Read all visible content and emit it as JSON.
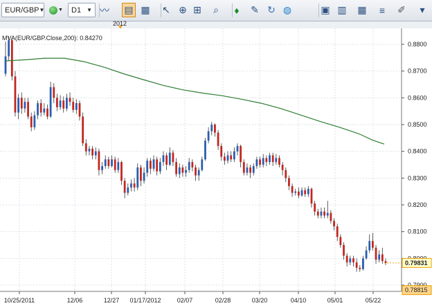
{
  "toolbar": {
    "symbol": "EUR/GBP",
    "timeframe": "D1",
    "tools": [
      {
        "name": "line-chart-icon",
        "x": 151
      },
      {
        "name": "chart-type-icon",
        "x": 186
      },
      {
        "name": "chart-window-icon",
        "x": 210
      },
      {
        "name": "cursor-icon",
        "x": 240
      },
      {
        "name": "crosshair-icon",
        "x": 264
      },
      {
        "name": "zoom-icon",
        "x": 285
      },
      {
        "name": "search-icon",
        "x": 312
      },
      {
        "name": "marker-icon",
        "x": 342
      },
      {
        "name": "note-icon",
        "x": 368
      },
      {
        "name": "refresh-icon",
        "x": 392
      },
      {
        "name": "globe-icon",
        "x": 415
      },
      {
        "name": "image-icon",
        "x": 470
      },
      {
        "name": "table-icon",
        "x": 494
      },
      {
        "name": "grid-icon",
        "x": 523
      },
      {
        "name": "lines-icon",
        "x": 552
      },
      {
        "name": "pen-icon",
        "x": 580
      },
      {
        "name": "options-icon",
        "x": 610
      }
    ]
  },
  "period_label": "2012",
  "indicator_label": "MVA(EUR/GBP.Close,200): 0.84270",
  "chart_data": {
    "type": "candlestick",
    "symbol": "EUR/GBP",
    "timeframe": "D1",
    "ylim": [
      0.787,
      0.88
    ],
    "yticks": [
      "0.8800",
      "0.8700",
      "0.8600",
      "0.8500",
      "0.8400",
      "0.8300",
      "0.8200",
      "0.8100",
      "0.8000",
      "0.7900"
    ],
    "xticks": [
      "10/25/2011",
      "12/06",
      "12/27",
      "01/17/2012",
      "02/07",
      "02/28",
      "03/20",
      "04/10",
      "05/01",
      "05/22"
    ],
    "last_price": "0.79831",
    "low_marker": "0.78815",
    "indicator": {
      "name": "MVA(EUR/GBP.Close,200)",
      "last_value": 0.8427
    },
    "candles": [
      [
        0.869,
        0.8755,
        0.881,
        0.868
      ],
      [
        0.8755,
        0.8815,
        0.883,
        0.874
      ],
      [
        0.8815,
        0.868,
        0.882,
        0.8665
      ],
      [
        0.868,
        0.8545,
        0.87,
        0.853
      ],
      [
        0.8545,
        0.86,
        0.8615,
        0.852
      ],
      [
        0.86,
        0.856,
        0.862,
        0.854
      ],
      [
        0.856,
        0.8585,
        0.86,
        0.8545
      ],
      [
        0.8585,
        0.853,
        0.86,
        0.852
      ],
      [
        0.853,
        0.849,
        0.8545,
        0.8475
      ],
      [
        0.849,
        0.8535,
        0.855,
        0.848
      ],
      [
        0.8535,
        0.858,
        0.859,
        0.852
      ],
      [
        0.858,
        0.8545,
        0.8595,
        0.853
      ],
      [
        0.8545,
        0.856,
        0.858,
        0.8535
      ],
      [
        0.856,
        0.853,
        0.8575,
        0.852
      ],
      [
        0.853,
        0.864,
        0.866,
        0.8525
      ],
      [
        0.864,
        0.86,
        0.8655,
        0.858
      ],
      [
        0.86,
        0.8565,
        0.8615,
        0.855
      ],
      [
        0.8565,
        0.859,
        0.861,
        0.8555
      ],
      [
        0.859,
        0.856,
        0.8605,
        0.8545
      ],
      [
        0.856,
        0.86,
        0.8615,
        0.855
      ],
      [
        0.86,
        0.8585,
        0.862,
        0.857
      ],
      [
        0.8585,
        0.8555,
        0.86,
        0.8545
      ],
      [
        0.8555,
        0.858,
        0.8595,
        0.854
      ],
      [
        0.858,
        0.853,
        0.859,
        0.8515
      ],
      [
        0.853,
        0.843,
        0.8545,
        0.842
      ],
      [
        0.843,
        0.84,
        0.8445,
        0.8385
      ],
      [
        0.84,
        0.841,
        0.842,
        0.8385
      ],
      [
        0.841,
        0.8385,
        0.842,
        0.837
      ],
      [
        0.8385,
        0.84,
        0.8415,
        0.837
      ],
      [
        0.84,
        0.833,
        0.841,
        0.831
      ],
      [
        0.833,
        0.8345,
        0.836,
        0.8315
      ],
      [
        0.8345,
        0.837,
        0.8385,
        0.8335
      ],
      [
        0.837,
        0.8345,
        0.838,
        0.8335
      ],
      [
        0.8345,
        0.837,
        0.8385,
        0.834
      ],
      [
        0.837,
        0.833,
        0.838,
        0.832
      ],
      [
        0.833,
        0.836,
        0.8375,
        0.832
      ],
      [
        0.836,
        0.829,
        0.8365,
        0.8275
      ],
      [
        0.829,
        0.8245,
        0.83,
        0.8225
      ],
      [
        0.8245,
        0.8265,
        0.828,
        0.8235
      ],
      [
        0.8265,
        0.828,
        0.8295,
        0.825
      ],
      [
        0.828,
        0.8265,
        0.83,
        0.825
      ],
      [
        0.8265,
        0.834,
        0.8355,
        0.8255
      ],
      [
        0.834,
        0.829,
        0.835,
        0.827
      ],
      [
        0.829,
        0.832,
        0.834,
        0.828
      ],
      [
        0.832,
        0.8365,
        0.8375,
        0.8305
      ],
      [
        0.8365,
        0.8335,
        0.8375,
        0.8315
      ],
      [
        0.8335,
        0.837,
        0.8385,
        0.8325
      ],
      [
        0.837,
        0.8325,
        0.838,
        0.831
      ],
      [
        0.8325,
        0.836,
        0.8375,
        0.8315
      ],
      [
        0.836,
        0.8385,
        0.84,
        0.8345
      ],
      [
        0.8385,
        0.835,
        0.8395,
        0.833
      ],
      [
        0.835,
        0.8395,
        0.8415,
        0.8345
      ],
      [
        0.8395,
        0.836,
        0.8405,
        0.8345
      ],
      [
        0.836,
        0.8315,
        0.8375,
        0.8305
      ],
      [
        0.8315,
        0.834,
        0.8355,
        0.83
      ],
      [
        0.834,
        0.832,
        0.835,
        0.8305
      ],
      [
        0.832,
        0.833,
        0.8345,
        0.8305
      ],
      [
        0.833,
        0.836,
        0.8375,
        0.832
      ],
      [
        0.836,
        0.834,
        0.837,
        0.8325
      ],
      [
        0.834,
        0.831,
        0.835,
        0.829
      ],
      [
        0.831,
        0.833,
        0.834,
        0.829
      ],
      [
        0.833,
        0.837,
        0.838,
        0.8325
      ],
      [
        0.837,
        0.844,
        0.845,
        0.8365
      ],
      [
        0.844,
        0.8475,
        0.849,
        0.843
      ],
      [
        0.8475,
        0.85,
        0.851,
        0.846
      ],
      [
        0.85,
        0.847,
        0.8505,
        0.8455
      ],
      [
        0.847,
        0.842,
        0.848,
        0.8405
      ],
      [
        0.842,
        0.838,
        0.843,
        0.8365
      ],
      [
        0.838,
        0.8365,
        0.8395,
        0.835
      ],
      [
        0.8365,
        0.8385,
        0.84,
        0.8355
      ],
      [
        0.8385,
        0.837,
        0.84,
        0.836
      ],
      [
        0.837,
        0.84,
        0.8415,
        0.836
      ],
      [
        0.84,
        0.842,
        0.843,
        0.8385
      ],
      [
        0.842,
        0.836,
        0.8425,
        0.834
      ],
      [
        0.836,
        0.832,
        0.837,
        0.831
      ],
      [
        0.832,
        0.834,
        0.8355,
        0.831
      ],
      [
        0.834,
        0.832,
        0.835,
        0.83
      ],
      [
        0.832,
        0.8345,
        0.8355,
        0.831
      ],
      [
        0.8345,
        0.837,
        0.838,
        0.8335
      ],
      [
        0.837,
        0.835,
        0.838,
        0.834
      ],
      [
        0.835,
        0.8375,
        0.839,
        0.834
      ],
      [
        0.8375,
        0.836,
        0.8385,
        0.8345
      ],
      [
        0.836,
        0.8385,
        0.8395,
        0.835
      ],
      [
        0.8385,
        0.836,
        0.8395,
        0.8345
      ],
      [
        0.836,
        0.8375,
        0.839,
        0.835
      ],
      [
        0.8375,
        0.835,
        0.8385,
        0.834
      ],
      [
        0.835,
        0.833,
        0.836,
        0.831
      ],
      [
        0.833,
        0.83,
        0.834,
        0.8285
      ],
      [
        0.83,
        0.827,
        0.831,
        0.8255
      ],
      [
        0.827,
        0.8245,
        0.828,
        0.823
      ],
      [
        0.8245,
        0.825,
        0.826,
        0.8235
      ],
      [
        0.825,
        0.8235,
        0.8265,
        0.8225
      ],
      [
        0.8235,
        0.8255,
        0.8265,
        0.823
      ],
      [
        0.8255,
        0.824,
        0.8265,
        0.823
      ],
      [
        0.824,
        0.826,
        0.827,
        0.823
      ],
      [
        0.826,
        0.8205,
        0.8265,
        0.819
      ],
      [
        0.8205,
        0.8175,
        0.8215,
        0.816
      ],
      [
        0.8175,
        0.816,
        0.8185,
        0.815
      ],
      [
        0.816,
        0.8175,
        0.819,
        0.815
      ],
      [
        0.8175,
        0.816,
        0.819,
        0.815
      ],
      [
        0.816,
        0.817,
        0.8215,
        0.815
      ],
      [
        0.817,
        0.814,
        0.818,
        0.813
      ],
      [
        0.814,
        0.812,
        0.815,
        0.8105
      ],
      [
        0.812,
        0.808,
        0.813,
        0.8065
      ],
      [
        0.808,
        0.805,
        0.809,
        0.804
      ],
      [
        0.805,
        0.801,
        0.806,
        0.7995
      ],
      [
        0.801,
        0.7985,
        0.802,
        0.797
      ],
      [
        0.7985,
        0.8,
        0.801,
        0.7975
      ],
      [
        0.8,
        0.7985,
        0.801,
        0.797
      ],
      [
        0.7985,
        0.7965,
        0.8,
        0.795
      ],
      [
        0.7965,
        0.796,
        0.7975,
        0.795
      ],
      [
        0.796,
        0.8,
        0.801,
        0.7955
      ],
      [
        0.8,
        0.803,
        0.8045,
        0.7995
      ],
      [
        0.803,
        0.8065,
        0.809,
        0.802
      ],
      [
        0.8065,
        0.804,
        0.8095,
        0.803
      ],
      [
        0.804,
        0.7995,
        0.805,
        0.798
      ],
      [
        0.7995,
        0.8015,
        0.803,
        0.7985
      ],
      [
        0.8015,
        0.799,
        0.804,
        0.798
      ],
      [
        0.799,
        0.7983,
        0.8,
        0.7975
      ]
    ],
    "mva": [
      [
        0,
        0.8738
      ],
      [
        15,
        0.8742
      ],
      [
        30,
        0.8748
      ],
      [
        45,
        0.8748
      ],
      [
        60,
        0.8735
      ],
      [
        75,
        0.8715
      ],
      [
        90,
        0.869
      ],
      [
        105,
        0.8668
      ],
      [
        120,
        0.8647
      ],
      [
        135,
        0.863
      ],
      [
        150,
        0.8618
      ],
      [
        165,
        0.8608
      ],
      [
        180,
        0.8595
      ],
      [
        195,
        0.858
      ],
      [
        210,
        0.856
      ],
      [
        225,
        0.8536
      ],
      [
        240,
        0.8512
      ],
      [
        255,
        0.849
      ],
      [
        270,
        0.8465
      ],
      [
        280,
        0.8442
      ],
      [
        289,
        0.8427
      ]
    ]
  },
  "colors": {
    "bull": "#2a5db0",
    "bear": "#c0271f",
    "mva": "#2e7d32",
    "grid": "#dde2e8",
    "axis": "#555555",
    "price_bg": "#ffffcc",
    "price_border": "#e8a000",
    "low_bg": "#ffd58a"
  }
}
